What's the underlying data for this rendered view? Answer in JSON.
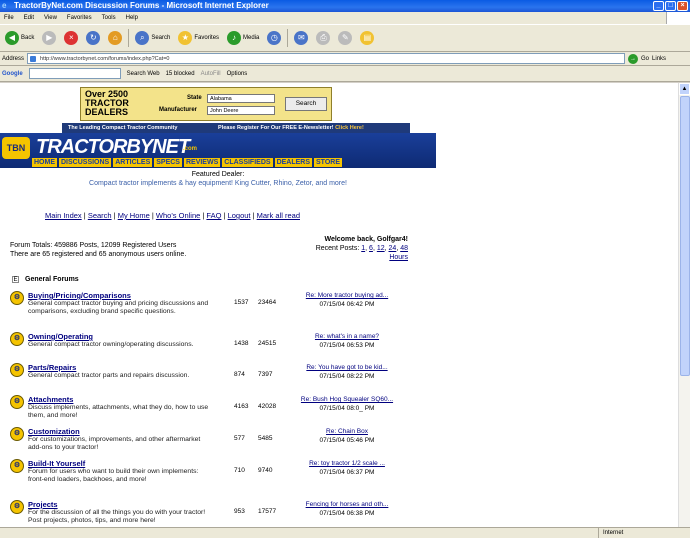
{
  "window": {
    "title": "TractorByNet.com Discussion Forums - Microsoft Internet Explorer"
  },
  "menu": [
    "File",
    "Edit",
    "View",
    "Favorites",
    "Tools",
    "Help"
  ],
  "toolbar": {
    "back": "Back",
    "search": "Search",
    "favorites": "Favorites",
    "media": "Media"
  },
  "address": {
    "label": "Address",
    "url": "http://www.tractorbynet.com/forums/index.php?Cat=0",
    "go": "Go",
    "links": "Links"
  },
  "google": {
    "label": "Google",
    "search_web": "Search Web",
    "blocked": "15 blocked",
    "autofill": "AutoFill",
    "options": "Options"
  },
  "banner": {
    "headline1": "Over 2500",
    "headline2": "TRACTOR",
    "headline3": "DEALERS",
    "state_label": "State",
    "state_value": "Alabama",
    "manufacturer_label": "Manufacturer",
    "manufacturer_value": "John Deere",
    "search_button": "Search"
  },
  "tagline": {
    "left": "The Leading Compact Tractor Community",
    "right": "Please Register For Our FREE E-Newsletter!",
    "click": "Click Here!"
  },
  "logo": {
    "name": "TRACTORBYNET",
    "dotcom": ".com"
  },
  "nav": [
    "HOME",
    "DISCUSSIONS",
    "ARTICLES",
    "SPECS",
    "REVIEWS",
    "CLASSIFIEDS",
    "DEALERS",
    "STORE"
  ],
  "featured": {
    "title": "Featured Dealer:",
    "text": "Compact tractor implements & hay equipment! King Cutter, Rhino, Zetor, and more!"
  },
  "links": [
    "Main Index",
    "Search",
    "My Home",
    "Who's Online",
    "FAQ",
    "Logout",
    "Mark all read"
  ],
  "totals": {
    "line1": "Forum Totals: 459886 Posts, 12099 Registered Users",
    "line2": "There are 65 registered and 65 anonymous users online."
  },
  "welcome": {
    "text": "Welcome back, Golfgar4!",
    "recent_label": "Recent Posts:",
    "recent": [
      "1",
      "6",
      "12",
      "24",
      "48"
    ],
    "hours": "Hours"
  },
  "section": {
    "toggle": "E",
    "title": "General Forums"
  },
  "forums": [
    {
      "name": "Buying/Pricing/Comparisons",
      "desc": "General compact tractor buying and pricing discussions and comparisons, excluding brand specific questions.",
      "posts": "1537",
      "threads": "23464",
      "last_title": "Re: More tractor buying ad...",
      "last_date": "07/15/04 06:42 PM"
    },
    {
      "name": "Owning/Operating",
      "desc": "General compact tractor owning/operating discussions.",
      "posts": "1438",
      "threads": "24515",
      "last_title": "Re: what's in a name?",
      "last_date": "07/15/04 06:53 PM"
    },
    {
      "name": "Parts/Repairs",
      "desc": "General compact tractor parts and repairs discussion.",
      "posts": "874",
      "threads": "7397",
      "last_title": "Re: You have got to be kid...",
      "last_date": "07/15/04 08:22 PM"
    },
    {
      "name": "Attachments",
      "desc": "Discuss implements, attachments, what they do, how to use them, and more!",
      "posts": "4163",
      "threads": "42028",
      "last_title": "Re: Bush Hog Squealer SQ60...",
      "last_date": "07/15/04 08:0_ PM"
    },
    {
      "name": "Customization",
      "desc": "For customizations, improvements, and other aftermarket add-ons to your tractor!",
      "posts": "577",
      "threads": "5485",
      "last_title": "Re: Chain Box",
      "last_date": "07/15/04 05:46 PM"
    },
    {
      "name": "Build-It Yourself",
      "desc": "Forum for users who want to build their own implements: front-end loaders, backhoes, and more!",
      "posts": "710",
      "threads": "9740",
      "last_title": "Re: toy tractor 1/2 scale ...",
      "last_date": "07/15/04 06:37 PM"
    },
    {
      "name": "Projects",
      "desc": "For the discussion of all the things you do with your tractor! Post projects, photos, tips, and more here!",
      "posts": "953",
      "threads": "17577",
      "last_title": "Fencing for horses and oth...",
      "last_date": "07/15/04 06:38 PM"
    }
  ],
  "status": {
    "text": "",
    "zone": "Internet"
  }
}
